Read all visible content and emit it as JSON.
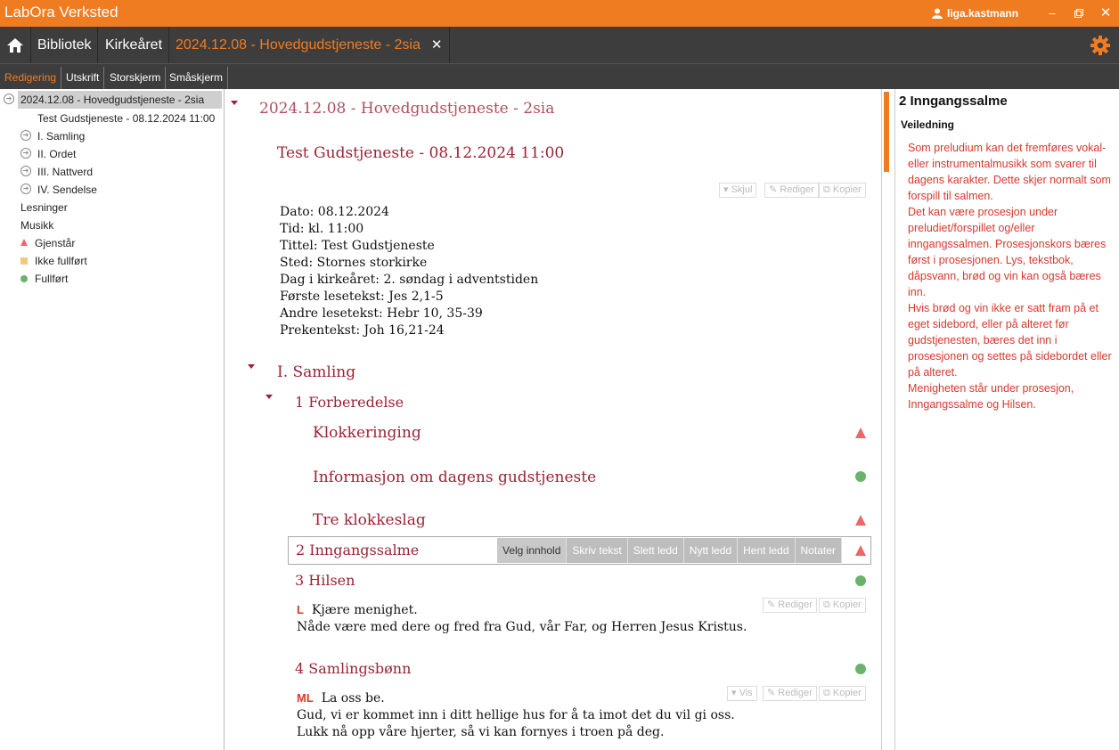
{
  "titlebar": {
    "app_title": "LabOra Verksted",
    "user": "liga.kastmann",
    "minimize_icon": "minimize-icon",
    "restore_icon": "restore-icon",
    "close_icon": "close-icon"
  },
  "nav": {
    "home_icon": "home-icon",
    "items": [
      "Bibliotek",
      "Kirkeåret"
    ],
    "document_tab": "2024.12.08 - Hovedgudstjeneste - 2sia",
    "close_tab": "✕",
    "settings_icon": "gear-icon",
    "accent_color": "#f07c22"
  },
  "subtabs": [
    "Redigering",
    "Utskrift",
    "Storskjerm",
    "Småskjerm"
  ],
  "tree": {
    "root": "2024.12.08 - Hovedgudstjeneste - 2sia",
    "service": "Test Gudstjeneste - 08.12.2024 11:00",
    "sections": [
      "I. Samling",
      "II. Ordet",
      "III. Nattverd",
      "IV. Sendelse"
    ],
    "lesninger": "Lesninger",
    "musikk": "Musikk",
    "legend": [
      "Gjenstår",
      "Ikke fullført",
      "Fullført"
    ]
  },
  "main": {
    "doc_title": "2024.12.08 - Hovedgudstjeneste - 2sia",
    "service_title": "Test Gudstjeneste - 08.12.2024 11:00",
    "header_buttons": [
      "Skjul",
      "Rediger",
      "Kopier"
    ],
    "info": [
      "Dato: 08.12.2024",
      "Tid: kl. 11:00",
      "Tittel: Test Gudstjeneste",
      "Sted: Stornes storkirke",
      "Dag i kirkeåret: 2. søndag i adventstiden",
      "Første lesetekst: Jes 2,1-5",
      "Andre lesetekst: Hebr 10, 35-39",
      "Prekentekst: Joh 16,21-24"
    ],
    "section_title": "I. Samling",
    "subsection_title": "1 Forberedelse",
    "items": [
      {
        "title": "Klokkeringing",
        "status": "Gjenstår"
      },
      {
        "title": "Informasjon om dagens gudstjeneste",
        "status": "Fullført"
      },
      {
        "title": "Tre klokkeslag",
        "status": "Gjenstår"
      }
    ],
    "selected_item": {
      "title": "2 Inngangssalme",
      "actions": [
        "Velg innhold",
        "Skriv tekst",
        "Slett ledd",
        "Nytt ledd",
        "Hent ledd",
        "Notater"
      ],
      "status": "Gjenstår"
    },
    "hilsen": {
      "title": "3 Hilsen",
      "status": "Fullført",
      "buttons": [
        "Rediger",
        "Kopier"
      ],
      "role": "L",
      "line1": "Kjære menighet.",
      "line2": "Nåde være med dere og fred fra Gud, vår Far, og Herren Jesus Kristus."
    },
    "samlingsbonn": {
      "title": "4 Samlingsbønn",
      "status": "Fullført",
      "buttons": [
        "Vis",
        "Rediger",
        "Kopier"
      ],
      "role": "ML",
      "line1": "La oss be.",
      "line2": "Gud, vi er kommet inn i ditt hellige hus for å ta imot det du vil gi oss.",
      "line3": "Lukk nå opp våre hjerter, så vi kan fornyes i troen på deg."
    }
  },
  "right": {
    "title": "2 Inngangssalme",
    "subtitle": "Veiledning",
    "paragraphs": [
      "Som preludium kan det fremføres vokal- eller instrumentalmusikk som svarer til dagens karakter. Dette skjer normalt som forspill til salmen.",
      "Det kan være prosesjon under preludiet/forspillet og/eller inngangssalmen. Prosesjonskors bæres først i prosesjonen. Lys, tekstbok, dåpsvann, brød og vin kan også bæres inn.",
      "Hvis brød og vin ikke er satt fram på et eget sidebord, eller på alteret før gudstjenesten, bæres det inn i prosesjonen og settes på sidebordet eller på alteret.",
      "Menigheten står under prosesjon, Inngangssalme og Hilsen."
    ]
  }
}
